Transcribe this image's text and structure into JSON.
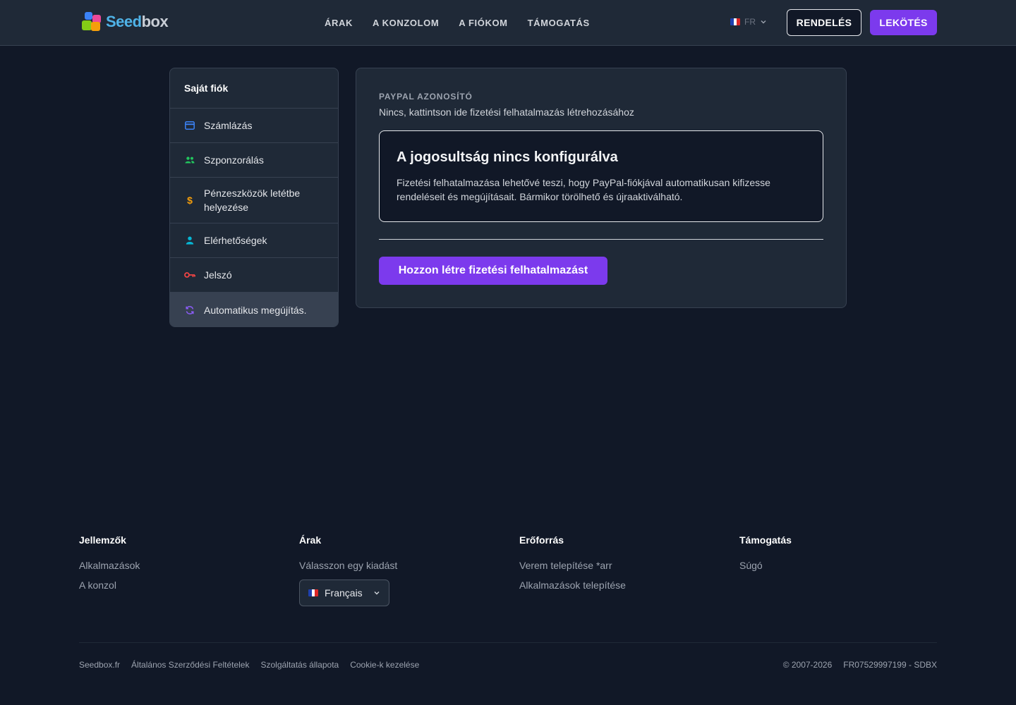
{
  "header": {
    "logo": {
      "part1": "Seed",
      "part2": "box"
    },
    "nav": [
      "ÁRAK",
      "A KONZOLOM",
      "A FIÓKOM",
      "TÁMOGATÁS"
    ],
    "lang": "FR",
    "order_label": "RENDELÉS",
    "commit_label": "LEKÖTÉS"
  },
  "sidebar": {
    "title": "Saját fiók",
    "items": [
      {
        "label": "Számlázás",
        "icon": "credit-card-icon"
      },
      {
        "label": "Szponzorálás",
        "icon": "users-icon"
      },
      {
        "label": "Pénzeszközök letétbe helyezése",
        "icon": "dollar-icon"
      },
      {
        "label": "Elérhetőségek",
        "icon": "user-icon"
      },
      {
        "label": "Jelszó",
        "icon": "key-icon"
      },
      {
        "label": "Automatikus megújítás.",
        "icon": "refresh-icon",
        "active": true
      }
    ]
  },
  "main": {
    "paypal_label": "PAYPAL AZONOSÍTÓ",
    "paypal_value": "Nincs, kattintson ide fizetési felhatalmazás létrehozásához",
    "alert_title": "A jogosultság nincs konfigurálva",
    "alert_text": "Fizetési felhatalmazása lehetővé teszi, hogy PayPal-fiókjával automatikusan kifizesse rendeléseit és megújításait. Bármikor törölhető és újraaktiválható.",
    "create_button": "Hozzon létre fizetési felhatalmazást"
  },
  "footer": {
    "columns": [
      {
        "title": "Jellemzők",
        "links": [
          "Alkalmazások",
          "A konzol"
        ]
      },
      {
        "title": "Árak",
        "links": [
          "Válasszon egy kiadást"
        ],
        "language": "Français"
      },
      {
        "title": "Erőforrás",
        "links": [
          "Verem telepítése *arr",
          "Alkalmazások telepítése"
        ]
      },
      {
        "title": "Támogatás",
        "links": [
          "Súgó"
        ]
      }
    ],
    "bottom_links": [
      "Seedbox.fr",
      "Általános Szerződési Feltételek",
      "Szolgáltatás állapota",
      "Cookie-k kezelése"
    ],
    "copyright": "© 2007-2026",
    "company_id": "FR07529997199 - SDBX"
  },
  "colors": {
    "background": "#111827",
    "surface": "#1f2937",
    "accent": "#7c3aed"
  }
}
